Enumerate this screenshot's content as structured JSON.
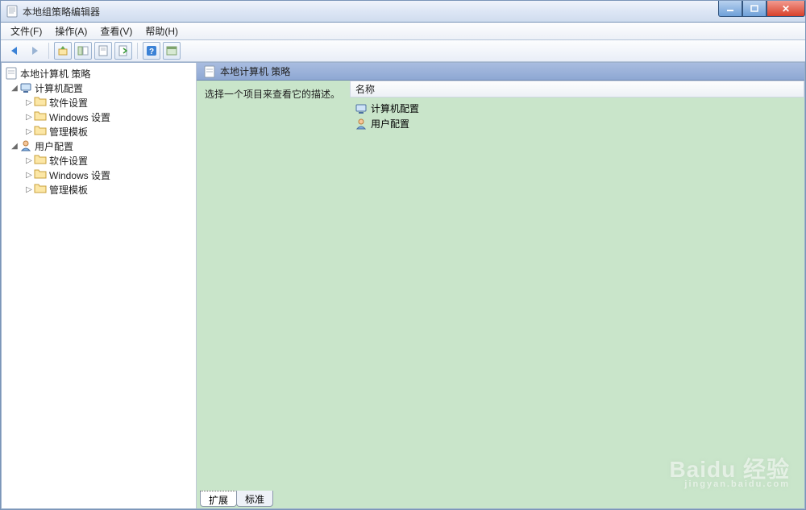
{
  "window": {
    "title": "本地组策略编辑器"
  },
  "menu": {
    "file": "文件(F)",
    "action": "操作(A)",
    "view": "查看(V)",
    "help": "帮助(H)"
  },
  "tree": {
    "root": "本地计算机 策略",
    "computer": {
      "label": "计算机配置",
      "software": "软件设置",
      "windows": "Windows 设置",
      "templates": "管理模板"
    },
    "user": {
      "label": "用户配置",
      "software": "软件设置",
      "windows": "Windows 设置",
      "templates": "管理模板"
    }
  },
  "pane": {
    "header": "本地计算机 策略",
    "hint": "选择一个项目来查看它的描述。",
    "column": "名称",
    "items": {
      "computer": "计算机配置",
      "user": "用户配置"
    }
  },
  "tabs": {
    "extended": "扩展",
    "standard": "标准"
  },
  "watermark": {
    "brand": "Baidu 经验",
    "url": "jingyan.baidu.com"
  }
}
